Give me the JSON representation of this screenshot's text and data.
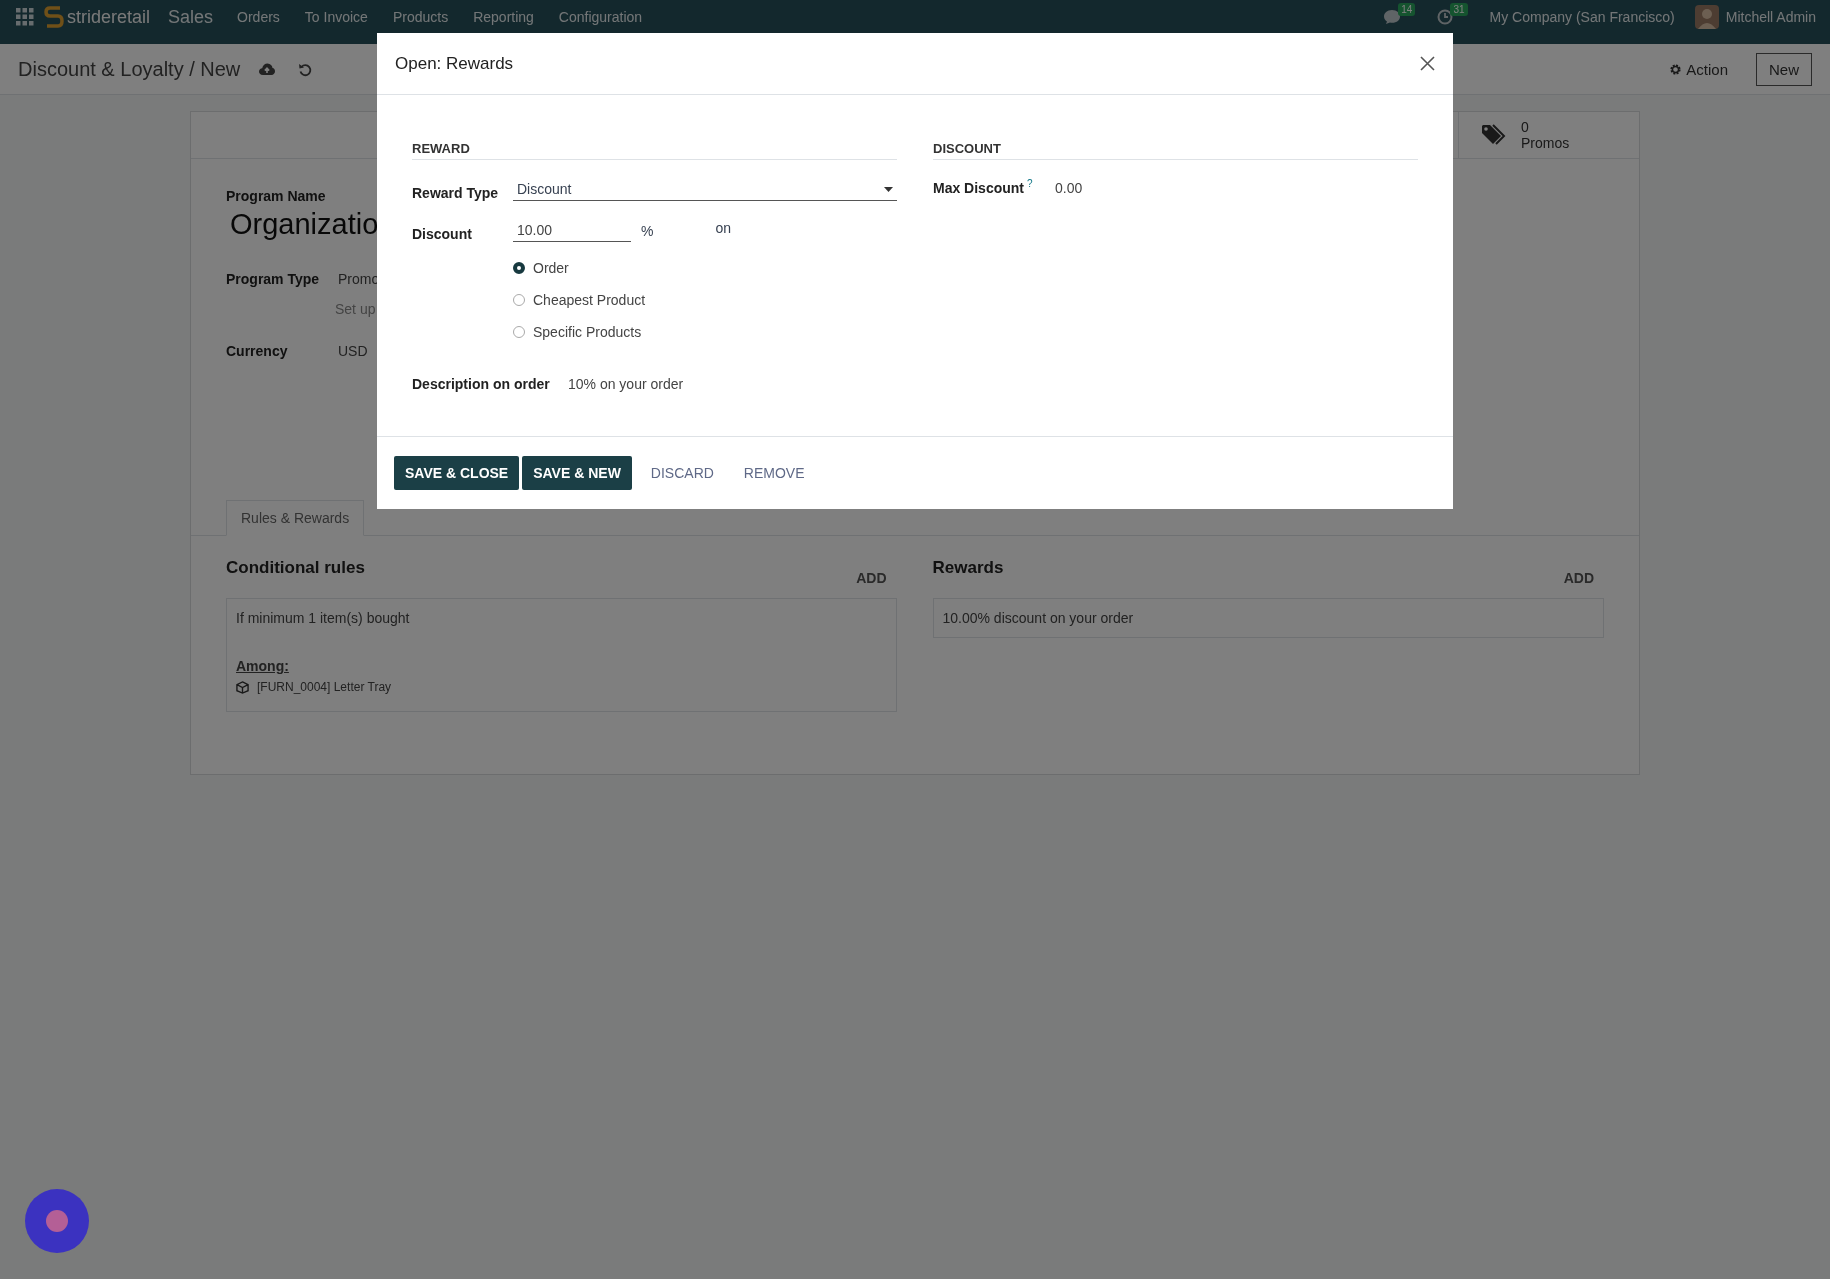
{
  "navbar": {
    "brand": "strideretail",
    "app_name": "Sales",
    "menu": [
      "Orders",
      "To Invoice",
      "Products",
      "Reporting",
      "Configuration"
    ],
    "messages_badge": "14",
    "activities_badge": "31",
    "company": "My Company (San Francisco)",
    "user": "Mitchell Admin"
  },
  "control_panel": {
    "breadcrumb": "Discount & Loyalty / New",
    "action": "Action",
    "new_button": "New"
  },
  "form": {
    "stat": {
      "value": "0",
      "label": "Promos"
    },
    "program_name": {
      "label": "Program Name",
      "value": "Organizatio"
    },
    "program_type": {
      "label": "Program Type",
      "value": "Promo",
      "hint": "Set up"
    },
    "currency": {
      "label": "Currency",
      "value": "USD"
    },
    "tabs": [
      {
        "label": "Rules & Rewards",
        "selected": true
      }
    ],
    "conditional_rules": {
      "title": "Conditional rules",
      "add": "ADD",
      "rule": "If minimum 1 item(s) bought",
      "among": "Among:",
      "product": "[FURN_0004] Letter Tray"
    },
    "rewards": {
      "title": "Rewards",
      "add": "ADD",
      "reward": "10.00% discount on your order"
    }
  },
  "dialog": {
    "title": "Open: Rewards",
    "reward_section": {
      "title": "REWARD",
      "reward_type": {
        "label": "Reward Type",
        "value": "Discount"
      },
      "discount": {
        "label": "Discount",
        "value": "10.00",
        "unit": "%",
        "on": "on"
      },
      "apply_on": [
        {
          "label": "Order",
          "selected": true
        },
        {
          "label": "Cheapest Product",
          "selected": false
        },
        {
          "label": "Specific Products",
          "selected": false
        }
      ],
      "description": {
        "label": "Description on order",
        "value": "10% on your order"
      }
    },
    "discount_section": {
      "title": "DISCOUNT",
      "max_discount": {
        "label": "Max Discount",
        "help": "?",
        "value": "0.00"
      }
    },
    "buttons": [
      {
        "label": "SAVE & CLOSE",
        "kind": "primary"
      },
      {
        "label": "SAVE & NEW",
        "kind": "primary"
      },
      {
        "label": "DISCARD",
        "kind": "link"
      },
      {
        "label": "REMOVE",
        "kind": "link"
      }
    ]
  }
}
